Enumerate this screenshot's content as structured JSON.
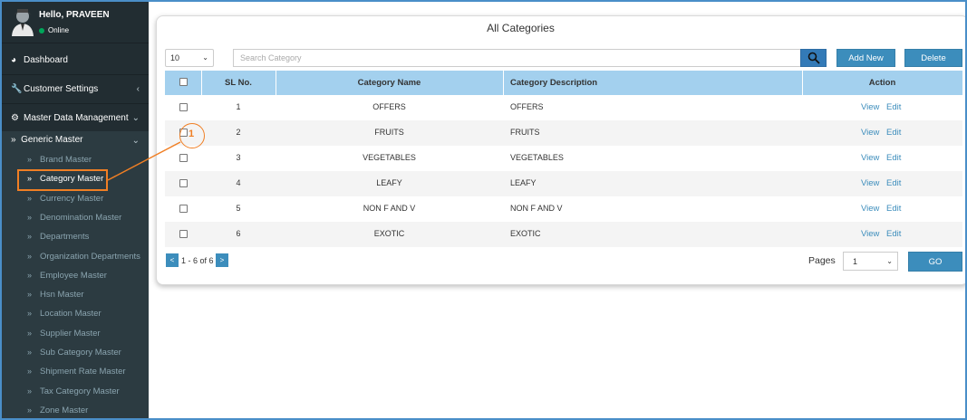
{
  "user": {
    "greeting": "Hello, PRAVEEN",
    "status": "Online"
  },
  "sidebar": {
    "dashboard": "Dashboard",
    "customer_settings": "Customer Settings",
    "master_data": "Master Data Management",
    "generic_master": "Generic Master",
    "items": [
      "Brand Master",
      "Category Master",
      "Currency Master",
      "Denomination Master",
      "Departments",
      "Organization Departments",
      "Employee Master",
      "Hsn Master",
      "Location Master",
      "Supplier Master",
      "Sub Category Master",
      "Shipment Rate Master",
      "Tax Category Master",
      "Zone Master"
    ],
    "active_item": "Category Master"
  },
  "main": {
    "title": "All Categories",
    "page_size": "10",
    "search_placeholder": "Search Category",
    "add_new": "Add New",
    "delete": "Delete",
    "columns": [
      "SL No.",
      "Category Name",
      "Category Description",
      "Action"
    ],
    "rows": [
      {
        "sl": "1",
        "name": "OFFERS",
        "desc": "OFFERS"
      },
      {
        "sl": "2",
        "name": "FRUITS",
        "desc": "FRUITS"
      },
      {
        "sl": "3",
        "name": "VEGETABLES",
        "desc": "VEGETABLES"
      },
      {
        "sl": "4",
        "name": "LEAFY",
        "desc": "LEAFY"
      },
      {
        "sl": "5",
        "name": "NON F AND V",
        "desc": "NON F AND V"
      },
      {
        "sl": "6",
        "name": "EXOTIC",
        "desc": "EXOTIC"
      }
    ],
    "view_label": "View",
    "edit_label": "Edit",
    "pager_prev": "<",
    "pager_next": ">",
    "pager_text": "1 - 6 of 6",
    "pages_label": "Pages",
    "pages_value": "1",
    "go_label": "GO"
  },
  "annotation": {
    "callout_number": "1"
  },
  "colors": {
    "sidebar": "#222d32",
    "accent": "#3c8dbc",
    "header": "#a3d0ee",
    "highlight": "#f07f24"
  }
}
